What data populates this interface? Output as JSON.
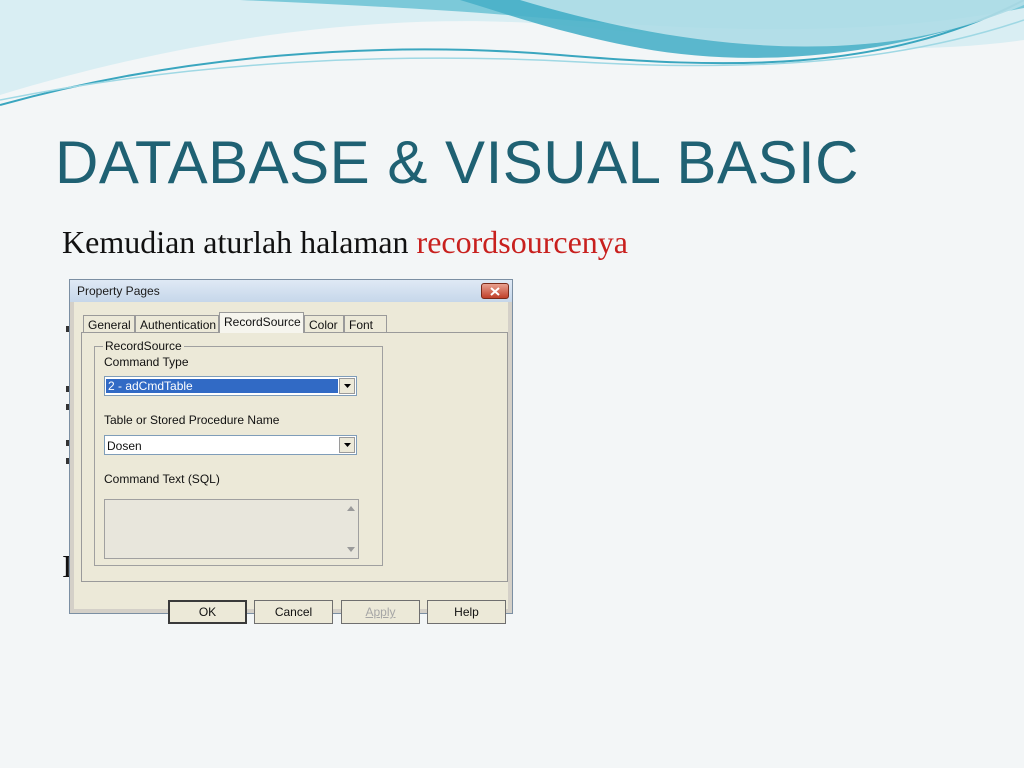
{
  "slide": {
    "title": "DATABASE & VISUAL BASIC",
    "body_prefix": "Kemudian aturlah halaman ",
    "body_highlight": "recordsourcenya",
    "stray_char": "I",
    "colors": {
      "title": "#1f6173",
      "highlight": "#c8201e",
      "wave": "#6fc5d6"
    }
  },
  "dialog": {
    "title": "Property Pages",
    "tabs": [
      {
        "label": "General"
      },
      {
        "label": "Authentication"
      },
      {
        "label": "RecordSource"
      },
      {
        "label": "Color"
      },
      {
        "label": "Font"
      }
    ],
    "active_tab": "RecordSource",
    "group_label": "RecordSource",
    "command_type_label": "Command Type",
    "command_type_value": "2 - adCmdTable",
    "table_label": "Table or Stored Procedure Name",
    "table_value": "Dosen",
    "command_text_label": "Command Text (SQL)",
    "command_text_value": "",
    "buttons": {
      "ok": "OK",
      "cancel": "Cancel",
      "apply": "Apply",
      "help": "Help"
    }
  }
}
